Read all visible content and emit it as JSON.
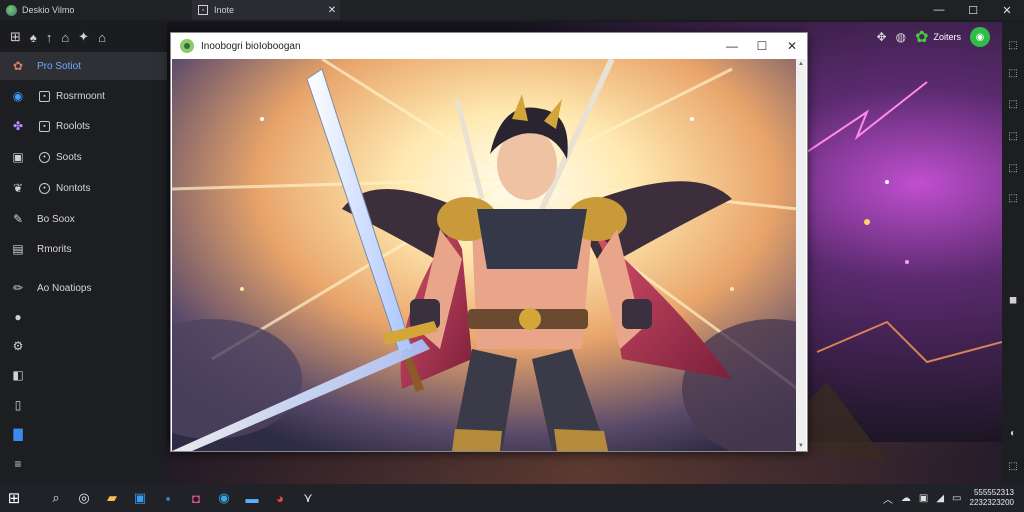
{
  "app": {
    "title": "Deskio Vilmo"
  },
  "tab": {
    "label": "Inote",
    "close": "✕"
  },
  "window_controls": {
    "minimize": "—",
    "maximize": "☐",
    "close": "✕"
  },
  "left_toolbar": {
    "icons": [
      "grid-icon",
      "shape-icon",
      "arrow-up-icon",
      "home-icon",
      "move-icon",
      "house-icon"
    ]
  },
  "sidebar": {
    "items": [
      {
        "label": "Pro Sotiot",
        "icon": "palette-icon",
        "active": true
      },
      {
        "label": "Rosrmoont",
        "icon": "circle-icon",
        "sub_icon": "square"
      },
      {
        "label": "Roolots",
        "icon": "puzzle-icon",
        "sub_icon": "square"
      },
      {
        "label": "Soots",
        "icon": "square-icon",
        "sub_icon": "round"
      },
      {
        "label": "Nontots",
        "icon": "leaf-icon",
        "sub_icon": "round"
      },
      {
        "label": "Bo Soox",
        "icon": "brush-icon"
      },
      {
        "label": "Rmorits",
        "icon": "image-icon"
      },
      {
        "label": "Ao Noatiops",
        "icon": "pen-icon"
      },
      {
        "label": "",
        "icon": "bubble-icon"
      },
      {
        "label": "",
        "icon": "gear-icon"
      },
      {
        "label": "",
        "icon": "book-icon"
      },
      {
        "label": "",
        "icon": "frame-icon"
      },
      {
        "label": "",
        "icon": "blue-file-icon"
      },
      {
        "label": "",
        "icon": "menu-icon"
      }
    ]
  },
  "canvas_toolbar": {
    "share_label": "Zoiters"
  },
  "viewer": {
    "title": "Inoobogri bioIoboogan"
  },
  "taskbar": {
    "clock_time": "555552313",
    "clock_date": "2232323200"
  },
  "colors": {
    "accent_green": "#2ebd45",
    "sidebar_bg": "#1d1e22",
    "taskbar_bg": "#202228"
  }
}
